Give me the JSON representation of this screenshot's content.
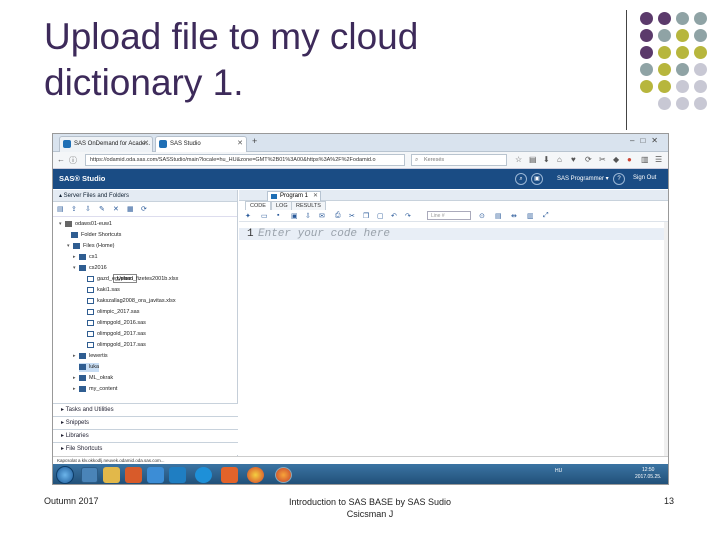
{
  "slide": {
    "title_line1": "Upload file to my cloud",
    "title_line2": "dictionary 1.",
    "footer_left": "Outumn 2017",
    "footer_mid_line1": "Introduction to SAS BASE by SAS Sudio",
    "footer_mid_line2": "Csicsman J",
    "page_number": "13"
  },
  "colors": {
    "title": "#3d2a5a",
    "dot_purple": "#5b3a6b",
    "dot_gray": "#8fa3a5",
    "dot_olive": "#b7b63d",
    "dot_light": "#c8c8d4",
    "sas_header": "#1a4c84"
  },
  "browser": {
    "tabs": [
      "SAS OnDemand for Acade...",
      "SAS Studio"
    ],
    "url": "https://odamid.oda.sas.com/SASStudio/main?locale=hu_HU&zone=GMT%2B01%3A00&https%3A%2F%2Fodamid.o",
    "search_placeholder": "Keresés"
  },
  "sas": {
    "logo": "SAS® Studio",
    "perspective": "SAS Programmer ▾",
    "signout": "Sign Out",
    "left_pane_title": "▴ Server Files and Folders",
    "upload_tooltip": "Upload",
    "tree": {
      "root": "odaws01-euw1",
      "folder_shortcuts": "Folder Shortcuts",
      "files_home": "Files (Home)",
      "cs1": "cs1",
      "cs2016": "cs2016",
      "file1": "gazd_egyetem_fizetes2001b.xlsx",
      "file2": "kaki1.sas",
      "file3": "kakszallag2008_ora_javitas.xlsx",
      "file4": "olimpic_2017.sas",
      "file5": "olimpgold_2016.sas",
      "file6": "olimpgold_2017.sas",
      "file7": "olimpgold_2017.sas",
      "lewertis": "lewertis",
      "luka": "luka",
      "ml_okrak": "ML_okrak",
      "my_content": "my_content"
    },
    "sections": {
      "tasks": "Tasks and Utilities",
      "snippets": "Snippets",
      "libraries": "Libraries",
      "file_shortcuts": "File Shortcuts"
    },
    "program_tab": "Program 1",
    "subtabs": [
      "CODE",
      "LOG",
      "RESULTS"
    ],
    "line_placeholder": "Line #",
    "line_number": "1",
    "code_placeholder": "Enter your code here"
  },
  "status_bar": "Kapcsolat a klv.okkodlj.neuvek.odamid.oda.sas.com...",
  "taskbar": {
    "tray": "HU",
    "clock_time": "12:50",
    "clock_date": "2017.05.25."
  }
}
